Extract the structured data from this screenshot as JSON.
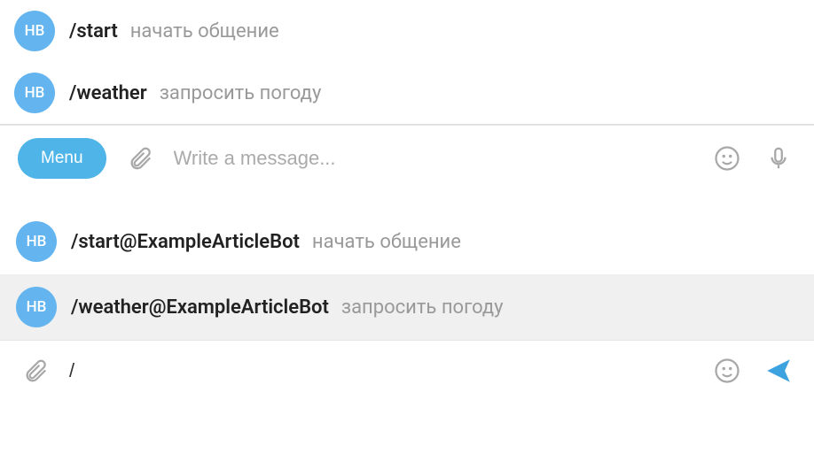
{
  "avatar_initials": "НВ",
  "top": {
    "commands": [
      {
        "cmd": "/start",
        "desc": "начать общение"
      },
      {
        "cmd": "/weather",
        "desc": "запросить погоду"
      }
    ],
    "input_bar": {
      "menu_label": "Menu",
      "placeholder": "Write a message...",
      "value": ""
    }
  },
  "bottom": {
    "commands": [
      {
        "cmd": "/start@ExampleArticleBot",
        "desc": "начать общение",
        "highlighted": false
      },
      {
        "cmd": "/weather@ExampleArticleBot",
        "desc": "запросить погоду",
        "highlighted": true
      }
    ],
    "input_bar": {
      "placeholder": "",
      "value": "/"
    }
  }
}
